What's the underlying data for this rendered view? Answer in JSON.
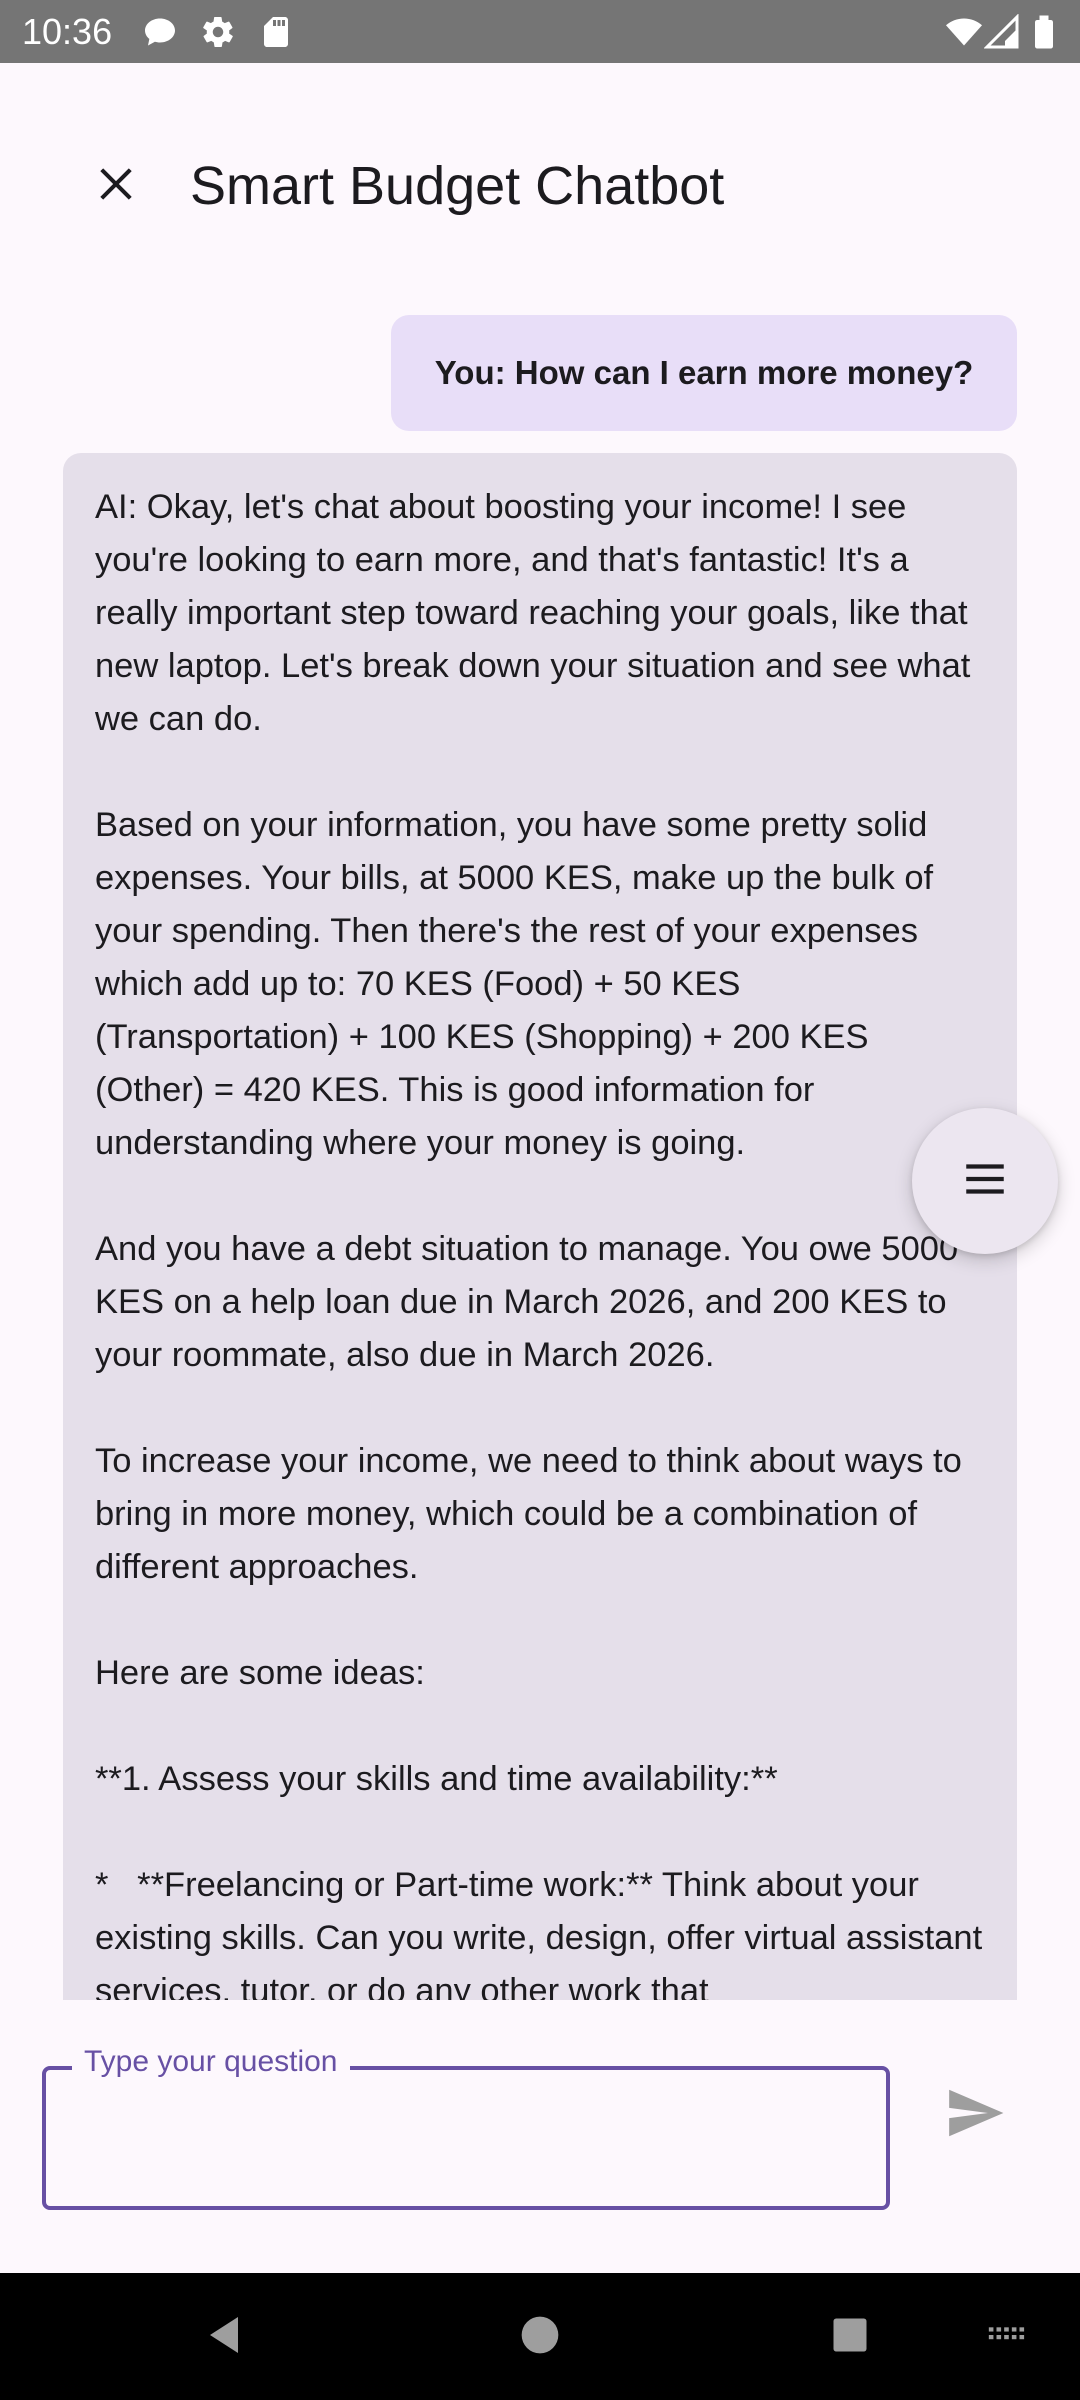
{
  "status_bar": {
    "time": "10:36",
    "left_icons": [
      "chat-bubble-icon",
      "gear-icon",
      "sd-card-icon"
    ],
    "right_icons": [
      "wifi-icon",
      "signal-icon",
      "battery-icon"
    ]
  },
  "app_bar": {
    "title": "Smart Budget Chatbot",
    "close_icon": "close-icon"
  },
  "chat": {
    "messages": [
      {
        "role": "user",
        "text": "You: How can I earn more money?"
      },
      {
        "role": "ai",
        "text": "AI: Okay, let's chat about boosting your income! I see you're looking to earn more, and that's fantastic! It's a really important step toward reaching your goals, like that new laptop. Let's break down your situation and see what we can do.\n\nBased on your information, you have some pretty solid expenses. Your bills, at 5000 KES, make up the bulk of your spending. Then there's the rest of your expenses which add up to: 70 KES (Food) + 50 KES (Transportation) + 100 KES (Shopping) + 200 KES (Other) = 420 KES. This is good information for understanding where your money is going.\n\nAnd you have a debt situation to manage. You owe 5000 KES on a help loan due in March 2026, and 200 KES to your roommate, also due in March 2026.\n\nTo increase your income, we need to think about ways to bring in more money, which could be a combination of different approaches.\n\nHere are some ideas:\n\n**1. Assess your skills and time availability:**\n\n*   **Freelancing or Part-time work:** Think about your existing skills. Can you write, design, offer virtual assistant services, tutor, or do any other work that"
      }
    ]
  },
  "fab": {
    "icon": "menu-icon"
  },
  "input": {
    "label": "Type your question",
    "value": "",
    "send_icon": "send-icon",
    "accent_color": "#6750a4"
  },
  "nav_bar": {
    "icons": [
      "back-icon",
      "home-icon",
      "recents-icon",
      "keyboard-icon"
    ]
  },
  "colors": {
    "user_bubble": "#e8def8",
    "ai_bubble": "#e5dfea",
    "background": "#fdf8fd",
    "status_bar": "#757575"
  }
}
